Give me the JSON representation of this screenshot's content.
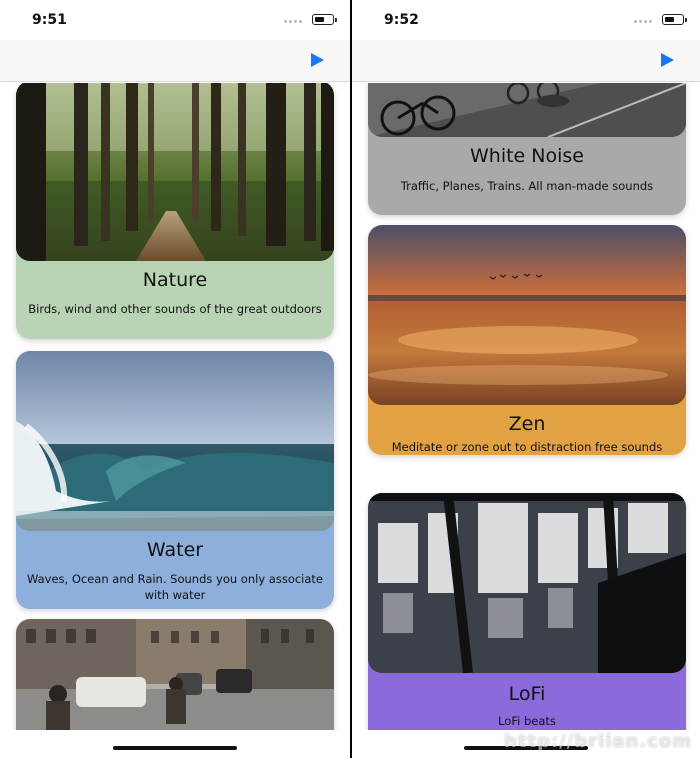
{
  "left_screen": {
    "status": {
      "time": "9:51"
    },
    "cards": [
      {
        "title": "Nature",
        "description": "Birds, wind and other sounds of the great outdoors",
        "color": "#b9d4b4"
      },
      {
        "title": "Water",
        "description": "Waves, Ocean and Rain. Sounds you only associate with water",
        "color": "#8eaedb"
      },
      {
        "title": "",
        "description": "",
        "color": "#999999"
      }
    ]
  },
  "right_screen": {
    "status": {
      "time": "9:52"
    },
    "cards": [
      {
        "title": "White Noise",
        "description": "Traffic, Planes, Trains. All man-made sounds",
        "color": "#a9a9a9"
      },
      {
        "title": "Zen",
        "description": "Meditate or zone out to distraction free sounds",
        "color": "#e2a243"
      },
      {
        "title": "LoFi",
        "description": "LoFi beats",
        "color": "#8b6bdc"
      }
    ]
  },
  "icons": {
    "play": "play-icon",
    "battery": "battery-icon",
    "signal": "signal-dots-icon"
  },
  "watermark": {
    "text": "http://briian.com"
  }
}
